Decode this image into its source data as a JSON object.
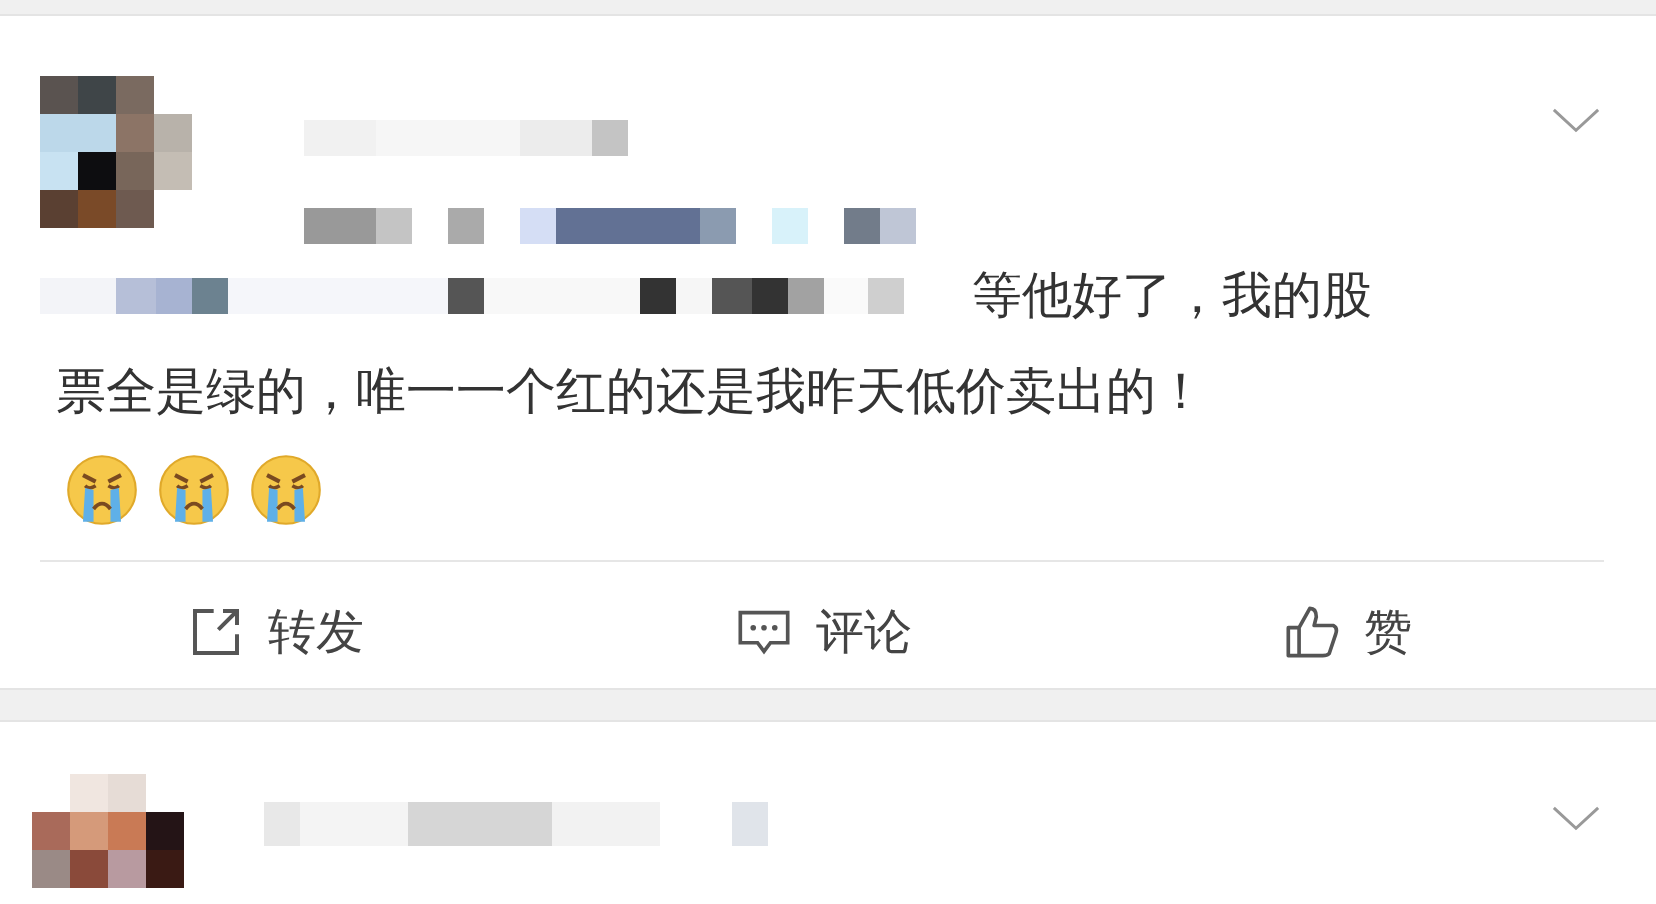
{
  "post": {
    "text_lines": [
      "等他好了，我的股",
      "票全是绿的，唯一一个红的还是我昨天低价卖出的！"
    ],
    "actions": [
      {
        "kind": "repost",
        "label": "转发"
      },
      {
        "kind": "comment",
        "label": "评论"
      },
      {
        "kind": "like",
        "label": "赞"
      }
    ]
  }
}
